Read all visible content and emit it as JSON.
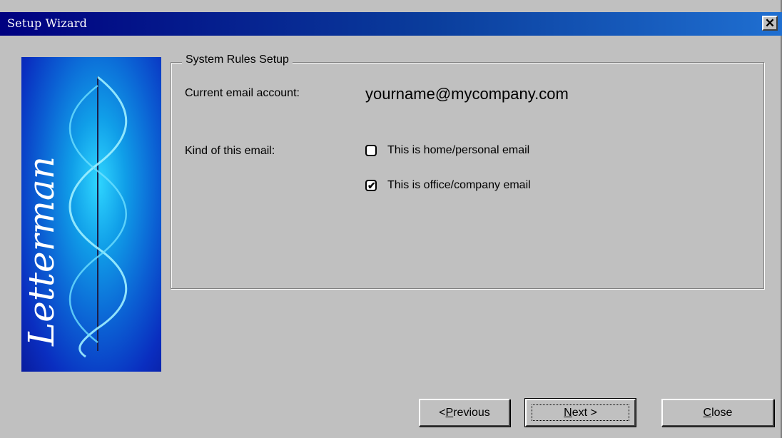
{
  "window": {
    "title": "Setup Wizard",
    "close_glyph": "✕"
  },
  "banner": {
    "logo_text": "Letterman"
  },
  "group": {
    "caption": "System Rules Setup"
  },
  "account": {
    "label": "Current email account:",
    "value": "yourname@mycompany.com"
  },
  "kind": {
    "label": "Kind of this email:"
  },
  "options": [
    {
      "label": "This is home/personal email",
      "checked": false
    },
    {
      "label": "This is office/company email",
      "checked": true
    }
  ],
  "buttons": {
    "previous": {
      "prefix": "< ",
      "mnemonic": "P",
      "rest": "revious"
    },
    "next": {
      "mnemonic": "N",
      "rest": "ext >"
    },
    "close": {
      "mnemonic": "C",
      "rest": "lose"
    }
  },
  "checkmark_glyph": "✔",
  "colors": {
    "titlebar_start": "#000080",
    "titlebar_end": "#1f6fd1",
    "face": "#c0c0c0"
  }
}
